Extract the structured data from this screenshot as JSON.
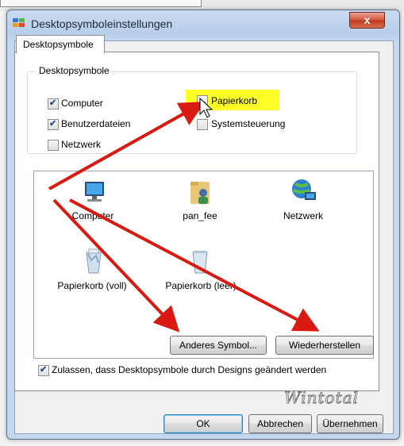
{
  "window": {
    "title": "Desktopsymboleinstellungen",
    "close_glyph": "x"
  },
  "tabs": [
    {
      "label": "Desktopsymbole"
    }
  ],
  "groupbox": {
    "label": "Desktopsymbole",
    "checkboxes": [
      {
        "label": "Computer",
        "checked": true
      },
      {
        "label": "Papierkorb",
        "checked": false
      },
      {
        "label": "Benutzerdateien",
        "checked": true
      },
      {
        "label": "Systemsteuerung",
        "checked": false
      },
      {
        "label": "Netzwerk",
        "checked": false
      }
    ]
  },
  "icons": [
    {
      "label": "Computer",
      "icon": "computer-icon"
    },
    {
      "label": "pan_fee",
      "icon": "user-folder-icon"
    },
    {
      "label": "Netzwerk",
      "icon": "network-icon"
    },
    {
      "label": "Papierkorb (voll)",
      "icon": "recycle-bin-full-icon"
    },
    {
      "label": "Papierkorb (leer)",
      "icon": "recycle-bin-empty-icon"
    }
  ],
  "buttons": {
    "change_icon": "Anderes Symbol...",
    "restore": "Wiederherstellen",
    "ok": "OK",
    "cancel": "Abbrechen",
    "apply": "Übernehmen"
  },
  "themes_checkbox": {
    "label": "Zulassen, dass Desktopsymbole durch Designs geändert werden",
    "checked": true
  },
  "watermark": "Wintotal",
  "colors": {
    "highlight": "#ffff27",
    "arrow": "#d81a12"
  }
}
